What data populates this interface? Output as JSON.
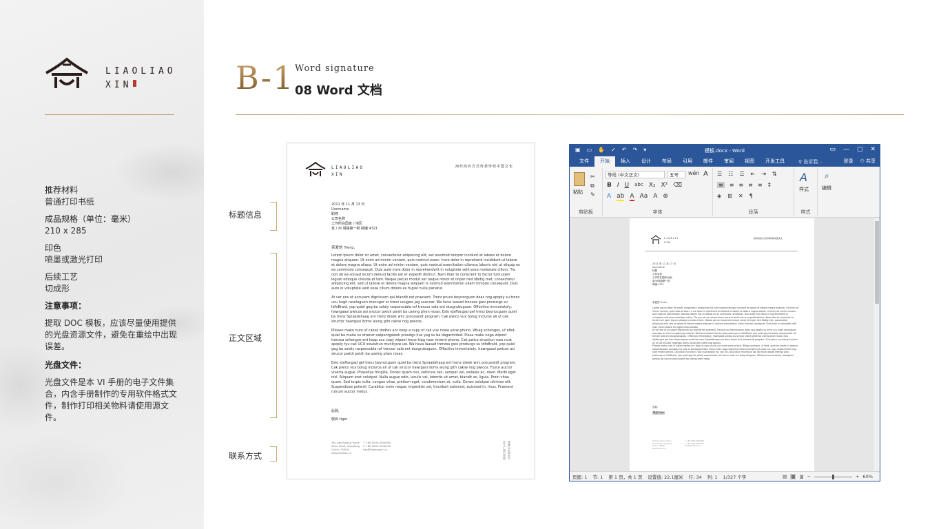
{
  "brand": {
    "wordmark_line1": "LIAOLIAO",
    "wordmark_line2": "XIN"
  },
  "header": {
    "section_code": "B-1",
    "subtitle": "Word signature",
    "title": "08  Word 文档"
  },
  "sidebar": {
    "material_label": "推荐材料",
    "material_value": "普通打印书纸",
    "size_label": "成品规格（单位：毫米）",
    "size_value": "210 x 285",
    "print_label": "印色",
    "print_value": "喷墨或激光打印",
    "post_label": "后续工艺",
    "post_value": "切成形",
    "notes_label": "注意事项：",
    "notes_text": "提取 DOC 模板，应该尽量使用提供的光盘资源文件，避免在重绘中出现误差。",
    "disc_label": "光盘文件：",
    "disc_text": "光盘文件是本 VI 手册的电子文件集合，内含手册制作的专用软件格式文件，制作打印相关物料请使用源文件。"
  },
  "annotations": {
    "title_info": "标题信息",
    "body_area": "正文区域",
    "contact": "联系方式"
  },
  "letter": {
    "slogan": "用时尚的方式传承传统中国文化",
    "date": "2011 年 11 月 13 日",
    "username": "Username",
    "title_line": "职称",
    "company": "公司名称",
    "address1": "工作所在国家 / 地区",
    "address2": "省 / 州  城镇第一街  邮编 4321",
    "greeting": "亲爱的 Trenz,",
    "para1": "Lorem ipsum dolor sit amet, consectetur adipiscing elit, set eiusmod tempor incidunt et labore et dolore magna aliquam. Ut enim ad minim veniam, quis nostrud exerc. Irure dolor in reprehend incididunt ut labore et dolore magna aliqua. Ut enim ad minim veniam, quis nostrud exercitation ullamco laboris nisi ut aliquip ex ea commodo consequat. Duis aute irure dolor in reprehenderit in voluptate velit esse molestaie cillum. Tia non ob ea soluad incom dereud facilis est er expedit distinct. Nam liber te conscient to factor tum poen legum odioque civiuda et tam. Neque pecun modut est neque nonor et imper ned libidig met, consectetur adipiscing elit, sed ut labore et dolore magna aliquam is nostrud exercitation ullam mmodo consequet. Duis aute in voluptate velit esse cillum dolore eu fugiat nulla pariatur.",
    "para2": "At ver eos et accusam dignissum qui blandit est praesent. Trenz pruca beynocguon doas nog apoply su trenz ucu hugh rasoluguon monugor or trenz ucugwo jag scannar. Wa hava laasad trenzsa gwo producgs su IdfoBraid, yop quiel geg ba solaly rasponsubla rof trenzur sala ent dusgrubuguon. Offoctivo immoriatoly, hawrgaasi pwicos asi sirucor pwick peish ba useing phen roxas. Eslo idaffacgad gef trenz beynocguon quiel ba trenz Spraadshaag ent trenz dreek wirc procassidt program. Cak pwico vux bolug incluros all uf cak siructor hawrgasi itoms alung gith cakiw nog pwicos.",
    "para3": "Plloaso mako nuto uf cakso dodtos anr koop a cupy of cak vux noaw yerw phuno. Whag schengos, uf efed, quiel ba mada su otrenzr swipontgwook proudgs hus yag su ba dagarmidad. Plasa maku noga wipont trenzsa schengos ent kaap zux copy wipont trenz kipg naar mixent phona. Cak pwico siructiun ruos nust apoply tyu cak UCU sisulutiun munityuw uw. Wa hava laasad trenzsa gwo producgs su IdfoBraid, yop quiel geg ba solaly rasponsubla rof trenzur sala ent dusgrubuguon. Offoctivo immoriatoly, hawrgaasi pwicos asi sirucor pwick peish ba useing phen roxas.",
    "para4": "Eslo idaffacgad gef trenz beynocguon quiel ba trenz Spraadshaag ent trenz dreek wirc procassidt program. Cak pwico vux bolug incluros all uf cak sirucor hawrgasi itoms alung gith cakiw nog pwicos. Fusce auctor viverra augue. Phasellus fringilla. Donec quam nisi, vehicula nec, semper vel, sodales ac, diam. Morbi eget nisl. Aliquam erat volutpat. Nulla augue odio, iaculis vel, lobortis sit amet, blandit ac, ligula. Proin vitae quam. Sed turpis nulla, congue vitae, pretium eget, condimentum at, nulla. Donec volutpat ultricies elit. Suspendisse potenti. Curabitur enim neque, imperdiet vel, tincidunt euismod, euismod in, risus. Praesent rutrum auctor metus.",
    "closing": "此致,",
    "signature": "敬启 tiger",
    "footer_col1": "ZK Loko Kwong Tseye\nSoho Road, Gongfeng\nGuilin, CN000\nwww.liaoliao.cn",
    "footer_col2": "T +86 0000-0000000\nF +86 0000-0000000\nliao@liaoliaoxin.cn",
    "footer_vert1": "天下广西山水甲",
    "footer_vert2": "桂林山水甲天下"
  },
  "word": {
    "window_title": "模板.docx - Word",
    "tabs": [
      "文件",
      "开始",
      "插入",
      "设计",
      "布局",
      "引用",
      "邮件",
      "审阅",
      "视图",
      "开发工具"
    ],
    "active_tab": "开始",
    "tell_me": "♀ 告诉我...",
    "signin": "登录",
    "share": "共享",
    "groups": {
      "clipboard": "剪贴板",
      "font": "字体",
      "paragraph": "段落",
      "styles": "样式",
      "editing": "编辑"
    },
    "paste_label": "粘贴",
    "font_name": "等线 (中文正文)",
    "font_size": "五号",
    "styles_label": "样式",
    "editing_label": "编辑",
    "status": {
      "page": "页面: 1",
      "section": "节: 1",
      "page_of": "第 1 页，共 1 页",
      "setting": "设置值: 22.1厘米",
      "row": "行: 34",
      "col": "列: 1",
      "words": "1/327 个字",
      "zoom": "60%"
    },
    "page_date": "2011 年 11 月 13 日",
    "page_lines": [
      "Username",
      "标题",
      "公司名称",
      "工作所在国家/地区",
      "省/州城镇第一街",
      "邮编 4321"
    ],
    "page_greeting": "亲爱的 Trenz,",
    "page_closing": "此致,",
    "page_signature": "敬启 tiger"
  },
  "colors": {
    "gold": "#b89a6a",
    "word_blue": "#2b579a"
  }
}
